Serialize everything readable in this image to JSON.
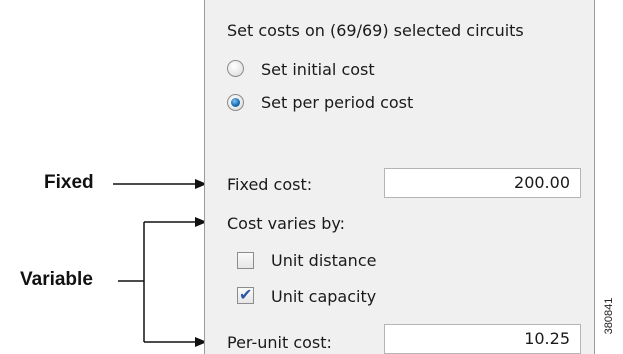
{
  "dialog": {
    "header": "Set costs on (69/69) selected circuits",
    "radio_initial": "Set initial cost",
    "radio_per_period": "Set per period cost",
    "fixed_cost_label": "Fixed cost:",
    "fixed_cost_value": "200.00",
    "cost_varies_label": "Cost varies by:",
    "unit_distance_label": "Unit distance",
    "unit_distance_checked": false,
    "unit_capacity_label": "Unit capacity",
    "unit_capacity_checked": true,
    "per_unit_cost_label": "Per-unit cost:",
    "per_unit_cost_value": "10.25",
    "selected_radio": "per_period"
  },
  "annotations": {
    "fixed": "Fixed",
    "variable": "Variable"
  },
  "figure_id": "380841",
  "colors": {
    "panel_bg": "#f0f0f0",
    "radio_selected": "#1a6fb5",
    "check_mark": "#2c56a8"
  }
}
